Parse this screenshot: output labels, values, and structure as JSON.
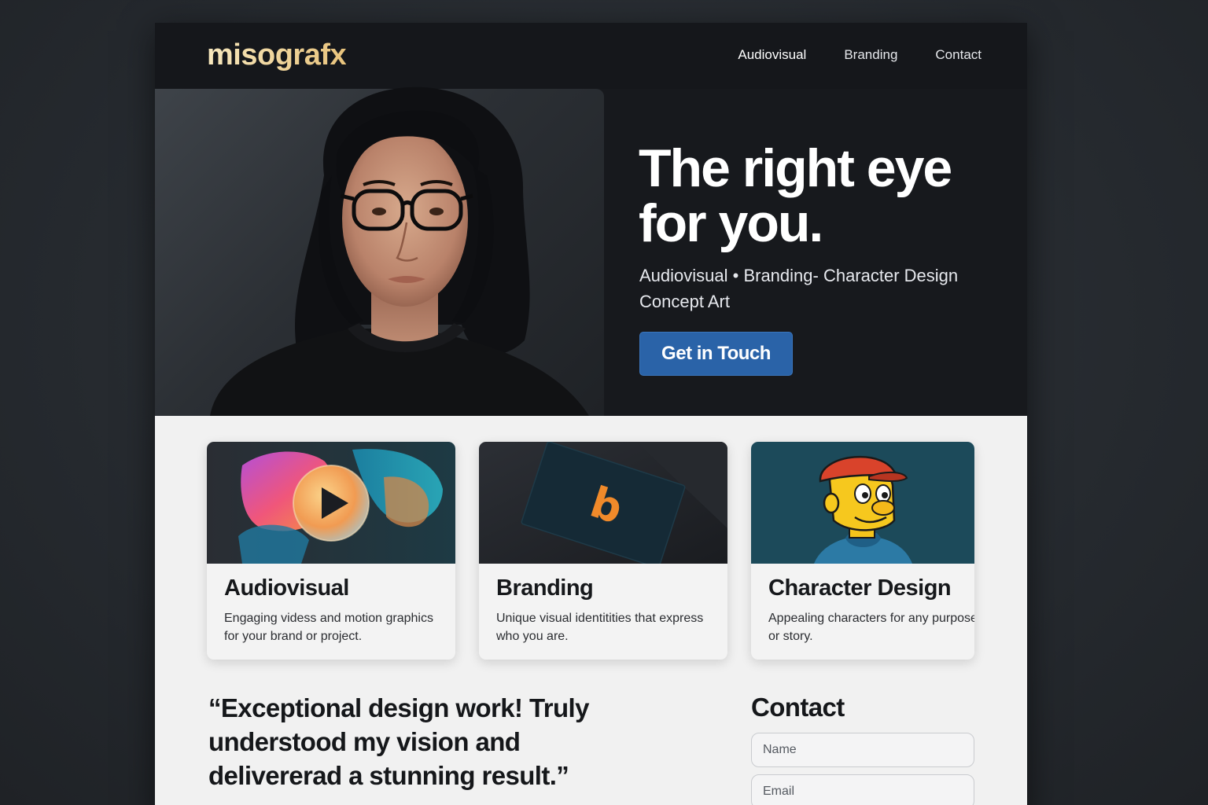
{
  "brand": {
    "logo": "misografx"
  },
  "nav": {
    "items": [
      {
        "label": "Audiovisual"
      },
      {
        "label": "Branding"
      },
      {
        "label": "Contact"
      }
    ]
  },
  "hero": {
    "title": "The right eye for you.",
    "subtitle": "Audiovisual • Branding- Character Design Concept Art",
    "cta_label": "Get in Touch",
    "cta_color": "#2a63a8"
  },
  "services": [
    {
      "title": "Audiovisual",
      "description": "Engaging videss and motion graphics for your brand or project.",
      "icon": "play-icon"
    },
    {
      "title": "Branding",
      "description": "Unique visual identitities that express who you are.",
      "icon": "business-card-logo",
      "mark": "b"
    },
    {
      "title": "Character Design",
      "description": "Appealing characters for any purpose or story.",
      "icon": "cartoon-character"
    }
  ],
  "testimonial": {
    "quote": "“Exceptional design work! Truly understood my vision and delivererad a stunning result.”"
  },
  "contact": {
    "title": "Contact",
    "name_placeholder": "Name",
    "email_placeholder": "Email"
  },
  "colors": {
    "background": "#24282d",
    "header": "#15171b",
    "logo": "#f1d79a",
    "card_bg": "#f3f3f3"
  }
}
